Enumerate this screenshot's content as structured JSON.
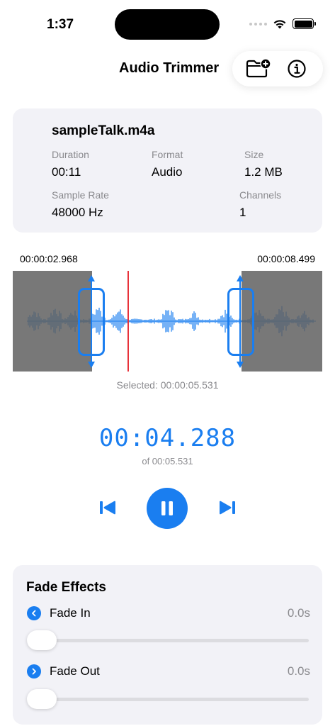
{
  "status": {
    "time": "1:37"
  },
  "nav": {
    "title": "Audio Trimmer",
    "icons": [
      "folder-plus-icon",
      "info-icon"
    ]
  },
  "file": {
    "name": "sampleTalk.m4a",
    "duration_label": "Duration",
    "duration": "00:11",
    "format_label": "Format",
    "format": "Audio",
    "size_label": "Size",
    "size": "1.2 MB",
    "sample_rate_label": "Sample Rate",
    "sample_rate": "48000 Hz",
    "channels_label": "Channels",
    "channels": "1"
  },
  "trim": {
    "start_time": "00:00:02.968",
    "end_time": "00:00:08.499",
    "selected": "Selected: 00:00:05.531"
  },
  "playback": {
    "current": "00:04.288",
    "of_total": "of 00:05.531",
    "state": "playing"
  },
  "fade": {
    "title": "Fade Effects",
    "fade_in_label": "Fade In",
    "fade_in_value": "0.0s",
    "fade_in_fraction": 0,
    "fade_out_label": "Fade Out",
    "fade_out_value": "0.0s",
    "fade_out_fraction": 0
  },
  "colors": {
    "accent": "#1a7ef0",
    "playhead": "#e8323a",
    "card": "#f2f2f7"
  }
}
